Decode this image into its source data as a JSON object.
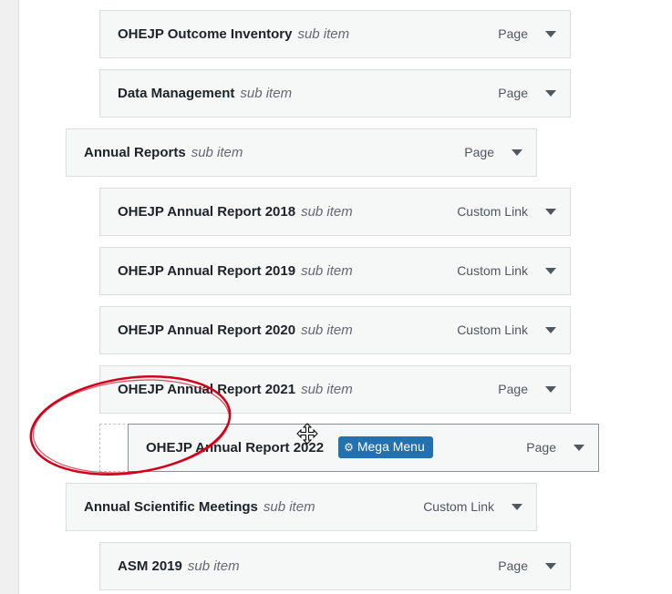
{
  "menu_items": [
    {
      "title": "OHEJP Outcome Inventory",
      "sub": "sub item",
      "type": "Page"
    },
    {
      "title": "Data Management",
      "sub": "sub item",
      "type": "Page"
    },
    {
      "title": "Annual Reports",
      "sub": "sub item",
      "type": "Page"
    },
    {
      "title": "OHEJP Annual Report 2018",
      "sub": "sub item",
      "type": "Custom Link"
    },
    {
      "title": "OHEJP Annual Report 2019",
      "sub": "sub item",
      "type": "Custom Link"
    },
    {
      "title": "OHEJP Annual Report 2020",
      "sub": "sub item",
      "type": "Custom Link"
    },
    {
      "title": "OHEJP Annual Report 2021",
      "sub": "sub item",
      "type": "Page"
    },
    {
      "title": "Annual Scientific Meetings",
      "sub": "sub item",
      "type": "Custom Link"
    },
    {
      "title": "ASM 2019",
      "sub": "sub item",
      "type": "Page"
    }
  ],
  "dragging_item": {
    "title": "OHEJP Annual Report 2022",
    "type": "Page",
    "mega_menu_label": "Mega Menu"
  },
  "colors": {
    "accent": "#2271b1",
    "annotation_circle": "#d0021b"
  },
  "icons": [
    "chevron-down-icon",
    "gear-icon",
    "move-cursor-icon"
  ]
}
